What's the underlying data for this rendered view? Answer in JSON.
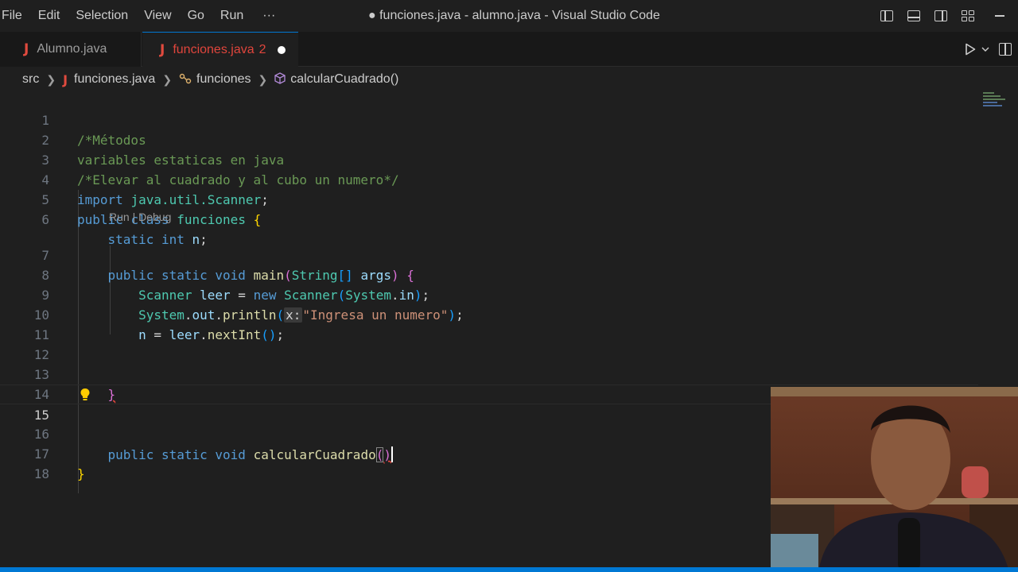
{
  "menu": [
    "File",
    "Edit",
    "Selection",
    "View",
    "Go",
    "Run",
    "···"
  ],
  "window_title": "● funciones.java - alumno.java - Visual Studio Code",
  "tabs": [
    {
      "icon": "J",
      "label": "Alumno.java",
      "active": false
    },
    {
      "icon": "J",
      "label": "funciones.java",
      "badge": "2",
      "active": true,
      "modified": true
    }
  ],
  "breadcrumb": {
    "folder": "src",
    "file_icon": "J",
    "file": "funciones.java",
    "class": "funciones",
    "method": "calcularCuadrado()"
  },
  "editor": {
    "line_numbers": [
      "1",
      "2",
      "3",
      "4",
      "5",
      "6",
      "7",
      "8",
      "9",
      "10",
      "11",
      "12",
      "13",
      "14",
      "15",
      "16",
      "17",
      "18"
    ],
    "active_line": "15",
    "codelens": "Run | Debug",
    "code": {
      "l1": "/*Métodos",
      "l2": "variables estaticas en java",
      "l3": "/*Elevar al cuadrado y al cubo un numero*/",
      "l4_kw": "import",
      "l4_pkg": "java.util.Scanner",
      "l5_kw1": "public",
      "l5_kw2": "class",
      "l5_name": "funciones",
      "l6_kw1": "static",
      "l6_kw2": "int",
      "l6_var": "n",
      "l7_kw1": "public",
      "l7_kw2": "static",
      "l7_kw3": "void",
      "l7_fn": "main",
      "l7_type": "String",
      "l7_arg": "args",
      "l8_type": "Scanner",
      "l8_var": "leer",
      "l8_new": "new",
      "l8_type2": "Scanner",
      "l8_sys": "System",
      "l8_in": "in",
      "l9_sys": "System",
      "l9_out": "out",
      "l9_fn": "println",
      "l9_hint": "x:",
      "l9_str": "\"Ingresa un numero\"",
      "l10_var": "n",
      "l10_obj": "leer",
      "l10_fn": "nextInt",
      "l15_kw1": "public",
      "l15_kw2": "static",
      "l15_kw3": "void",
      "l15_fn": "calcularCuadrado"
    }
  },
  "colors": {
    "accent": "#0078d4",
    "java_icon": "#e04a3e",
    "keyword": "#569cd6",
    "type": "#4ec9b0",
    "function": "#dcdcaa",
    "variable": "#9cdcfe",
    "comment": "#6a9955",
    "string": "#ce9178"
  },
  "webcam": {
    "description_icon": "presenter-webcam-overlay"
  }
}
